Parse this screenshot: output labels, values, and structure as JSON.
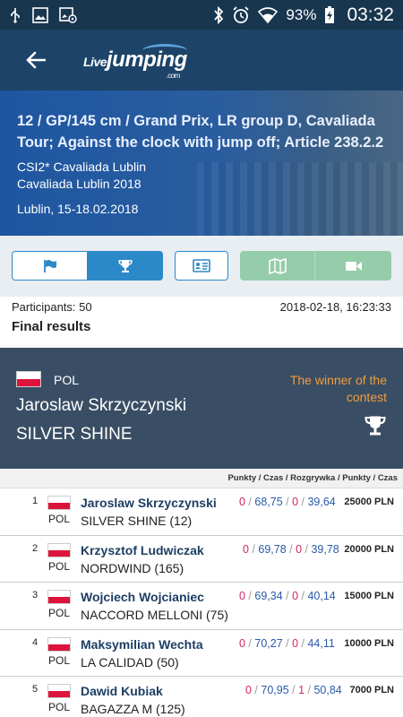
{
  "status_bar": {
    "battery": "93%",
    "time": "03:32",
    "icons": [
      "usb-icon",
      "image-icon",
      "image-settings-icon",
      "bluetooth-icon",
      "alarm-icon",
      "wifi-icon",
      "battery-charging-icon"
    ]
  },
  "app_bar": {
    "logo_part1": "Live",
    "logo_part2": "jumping",
    "logo_suffix": ".com",
    "back_icon": "arrow-left-icon"
  },
  "event": {
    "title": "12 / GP/145 cm / Grand Prix, LR group D, Cavaliada Tour; Against the clock with jump off; Article 238.2.2",
    "show": "CSI2* Cavaliada Lublin",
    "series": "Cavaliada Lublin 2018",
    "dates": "Lublin, 15-18.02.2018"
  },
  "buttons": [
    {
      "icon": "flag-icon",
      "selected": false
    },
    {
      "icon": "trophy-icon",
      "selected": true
    },
    {
      "icon": "id-card-icon",
      "selected": false
    },
    {
      "icon": "map-icon",
      "selected": false
    },
    {
      "icon": "video-camera-icon",
      "selected": false
    }
  ],
  "colors": {
    "header_dark": "#1d4468",
    "accent_blue": "#2b89c8",
    "accent_green": "#95ccaa",
    "winner_bg": "#394e64",
    "winner_label": "#f39c3a",
    "penalty": "#d1246a",
    "time": "#2a5aa8"
  },
  "participants": "Participants: 50",
  "timestamp": "2018-02-18, 16:23:33",
  "section_title": "Final results",
  "winner": {
    "country": "POL",
    "rider": "Jaroslaw Skrzyczynski",
    "horse": "SILVER SHINE",
    "label": "The winner of the contest"
  },
  "table_header": "Punkty / Czas / Rozgrywka / Punkty / Czas",
  "results": [
    {
      "pos": "1",
      "country": "POL",
      "rider": "Jaroslaw Skrzyczynski",
      "horse": "SILVER SHINE (12)",
      "pen1": "0",
      "time1": "68,75",
      "pen2": "0",
      "time2": "39,64",
      "prize": "25000 PLN"
    },
    {
      "pos": "2",
      "country": "POL",
      "rider": "Krzysztof Ludwiczak",
      "horse": "NORDWIND (165)",
      "pen1": "0",
      "time1": "69,78",
      "pen2": "0",
      "time2": "39,78",
      "prize": "20000 PLN"
    },
    {
      "pos": "3",
      "country": "POL",
      "rider": "Wojciech Wojcianiec",
      "horse": "NACCORD MELLONI (75)",
      "pen1": "0",
      "time1": "69,34",
      "pen2": "0",
      "time2": "40,14",
      "prize": "15000 PLN"
    },
    {
      "pos": "4",
      "country": "POL",
      "rider": "Maksymilian Wechta",
      "horse": "LA CALIDAD (50)",
      "pen1": "0",
      "time1": "70,27",
      "pen2": "0",
      "time2": "44,11",
      "prize": "10000 PLN"
    },
    {
      "pos": "5",
      "country": "POL",
      "rider": "Dawid Kubiak",
      "horse": "BAGAZZA M (125)",
      "pen1": "0",
      "time1": "70,95",
      "pen2": "1",
      "time2": "50,84",
      "prize": "7000 PLN"
    }
  ]
}
